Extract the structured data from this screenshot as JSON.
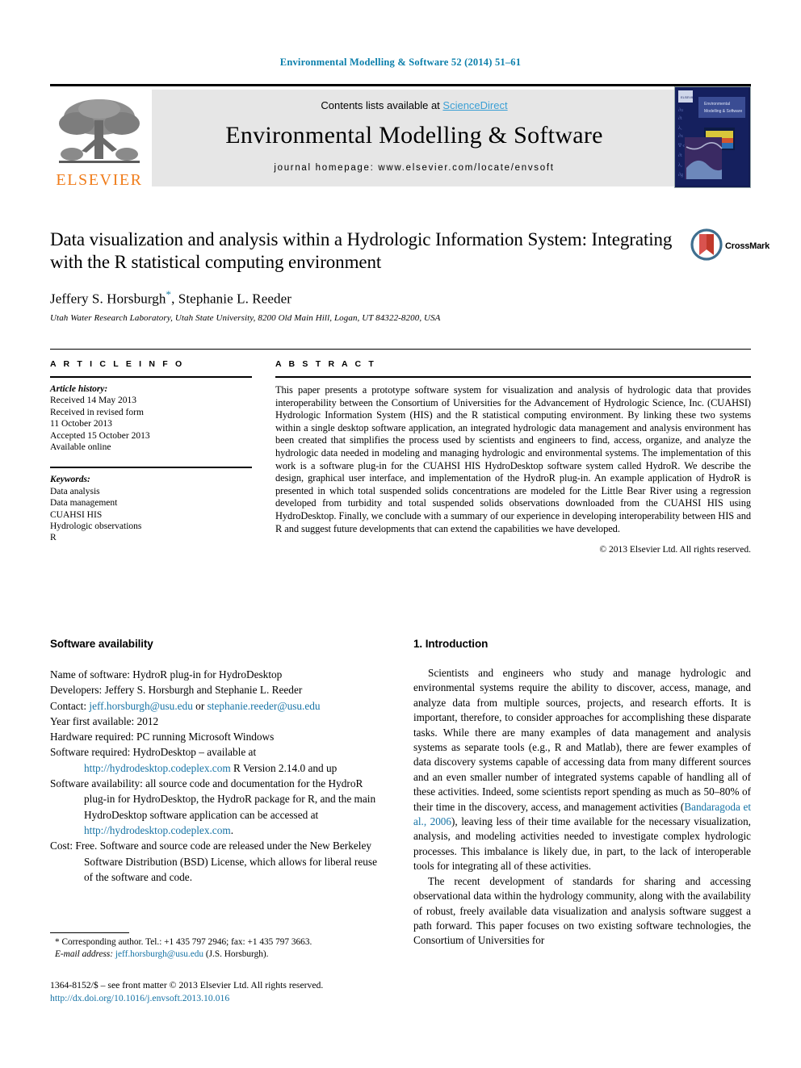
{
  "running_head": "Environmental Modelling & Software 52 (2014) 51–61",
  "masthead": {
    "publisher": "ELSEVIER",
    "contents_prefix": "Contents lists available at ",
    "sciencedirect": "ScienceDirect",
    "journal_title": "Environmental Modelling & Software",
    "homepage": "journal homepage: www.elsevier.com/locate/envsoft",
    "cover_caption": "Environmental Modelling & Software"
  },
  "article": {
    "title": "Data visualization and analysis within a Hydrologic Information System: Integrating with the R statistical computing environment",
    "authors": "Jeffery S. Horsburgh",
    "authors_rest": ", Stephanie L. Reeder",
    "affiliation": "Utah Water Research Laboratory, Utah State University, 8200 Old Main Hill, Logan, UT 84322-8200, USA",
    "crossmark_label": "CrossMark"
  },
  "article_info": {
    "heading": "A R T I C L E   I N F O",
    "history_label": "Article history:",
    "history": [
      "Received 14 May 2013",
      "Received in revised form",
      "11 October 2013",
      "Accepted 15 October 2013",
      "Available online"
    ],
    "keywords_label": "Keywords:",
    "keywords": [
      "Data analysis",
      "Data management",
      "CUAHSI HIS",
      "Hydrologic observations",
      "R"
    ]
  },
  "abstract": {
    "heading": "A B S T R A C T",
    "text": "This paper presents a prototype software system for visualization and analysis of hydrologic data that provides interoperability between the Consortium of Universities for the Advancement of Hydrologic Science, Inc. (CUAHSI) Hydrologic Information System (HIS) and the R statistical computing environment. By linking these two systems within a single desktop software application, an integrated hydrologic data management and analysis environment has been created that simplifies the process used by scientists and engineers to find, access, organize, and analyze the hydrologic data needed in modeling and managing hydrologic and environmental systems. The implementation of this work is a software plug-in for the CUAHSI HIS HydroDesktop software system called HydroR. We describe the design, graphical user interface, and implementation of the HydroR plug-in. An example application of HydroR is presented in which total suspended solids concentrations are modeled for the Little Bear River using a regression developed from turbidity and total suspended solids observations downloaded from the CUAHSI HIS using HydroDesktop. Finally, we conclude with a summary of our experience in developing interoperability between HIS and R and suggest future developments that can extend the capabilities we have developed.",
    "copyright": "© 2013 Elsevier Ltd. All rights reserved."
  },
  "software_availability": {
    "heading": "Software availability",
    "name_label": "Name of software:",
    "name_value": " HydroR plug-in for HydroDesktop",
    "developers_label": "Developers:",
    "developers_value": " Jeffery S. Horsburgh and Stephanie L. Reeder",
    "contact_label": "Contact:",
    "contact_email_1": "jeff.horsburgh@usu.edu",
    "contact_or": " or ",
    "contact_email_2": "stephanie.reeder@usu.edu",
    "year_label": "Year first available:",
    "year_value": " 2012",
    "hardware_label": "Hardware required:",
    "hardware_value": " PC running Microsoft Windows",
    "software_req_label": "Software required:",
    "software_req_value": " HydroDesktop – available at ",
    "software_req_link": "http://hydrodesktop.codeplex.com",
    "software_req_tail": " R Version 2.14.0 and up",
    "availability_label": "Software availability:",
    "availability_value": " all source code and documentation for the HydroR plug-in for HydroDesktop, the HydroR package for R, and the main HydroDesktop software application can be accessed at ",
    "availability_link": "http://hydrodesktop.codeplex.com",
    "availability_tail": ".",
    "cost_label": "Cost:",
    "cost_value": " Free. Software and source code are released under the New Berkeley Software Distribution (BSD) License, which allows for liberal reuse of the software and code."
  },
  "introduction": {
    "heading": "1.  Introduction",
    "paragraph_1_a": "Scientists and engineers who study and manage hydrologic and environmental systems require the ability to discover, access, manage, and analyze data from multiple sources, projects, and research efforts. It is important, therefore, to consider approaches for accomplishing these disparate tasks. While there are many examples of data management and analysis systems as separate tools (e.g., R and Matlab), there are fewer examples of data discovery systems capable of accessing data from many different sources and an even smaller number of integrated systems capable of handling all of these activities. Indeed, some scientists report spending as much as 50–80% of their time in the discovery, access, and management activities (",
    "paragraph_1_cite": "Bandaragoda et al., 2006",
    "paragraph_1_b": "), leaving less of their time available for the necessary visualization, analysis, and modeling activities needed to investigate complex hydrologic processes. This imbalance is likely due, in part, to the lack of interoperable tools for integrating all of these activities.",
    "paragraph_2": "The recent development of standards for sharing and accessing observational data within the hydrology community, along with the availability of robust, freely available data visualization and analysis software suggest a path forward. This paper focuses on two existing software technologies, the Consortium of Universities for"
  },
  "footnotes": {
    "corresponding": "* Corresponding author. Tel.: +1 435 797 2946; fax: +1 435 797 3663.",
    "email_label": "E-mail address:",
    "email_link": "jeff.horsburgh@usu.edu",
    "email_tail": " (J.S. Horsburgh).",
    "issn_line": "1364-8152/$ – see front matter © 2013 Elsevier Ltd. All rights reserved.",
    "doi_link": "http://dx.doi.org/10.1016/j.envsoft.2013.10.016"
  },
  "colors": {
    "link": "#1673a5",
    "runhead": "#0b7fab",
    "elsevier_orange": "#f07c1a",
    "sciencedirect": "#3a9fd4"
  }
}
